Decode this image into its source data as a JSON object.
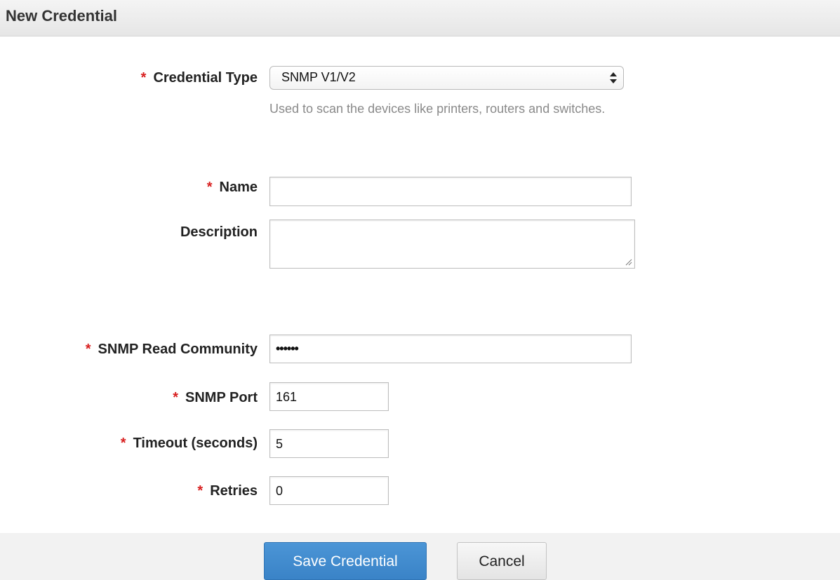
{
  "header": {
    "title": "New Credential"
  },
  "form": {
    "required_marker": "*",
    "credential_type": {
      "label": "Credential Type",
      "selected": "SNMP V1/V2",
      "help": "Used to scan the devices like printers, routers and switches."
    },
    "name": {
      "label": "Name",
      "value": ""
    },
    "description": {
      "label": "Description",
      "value": ""
    },
    "read_community": {
      "label": "SNMP Read Community",
      "value": "••••••"
    },
    "port": {
      "label": "SNMP Port",
      "value": "161"
    },
    "timeout": {
      "label": "Timeout (seconds)",
      "value": "5"
    },
    "retries": {
      "label": "Retries",
      "value": "0"
    }
  },
  "actions": {
    "save_label": "Save Credential",
    "cancel_label": "Cancel"
  },
  "colors": {
    "required": "#d81f1f",
    "primary": "#3f8acd",
    "help_text": "#8a8a8a"
  },
  "icons": {
    "select_arrows": "up-down-arrows-icon",
    "resize": "resize-grip-icon"
  }
}
